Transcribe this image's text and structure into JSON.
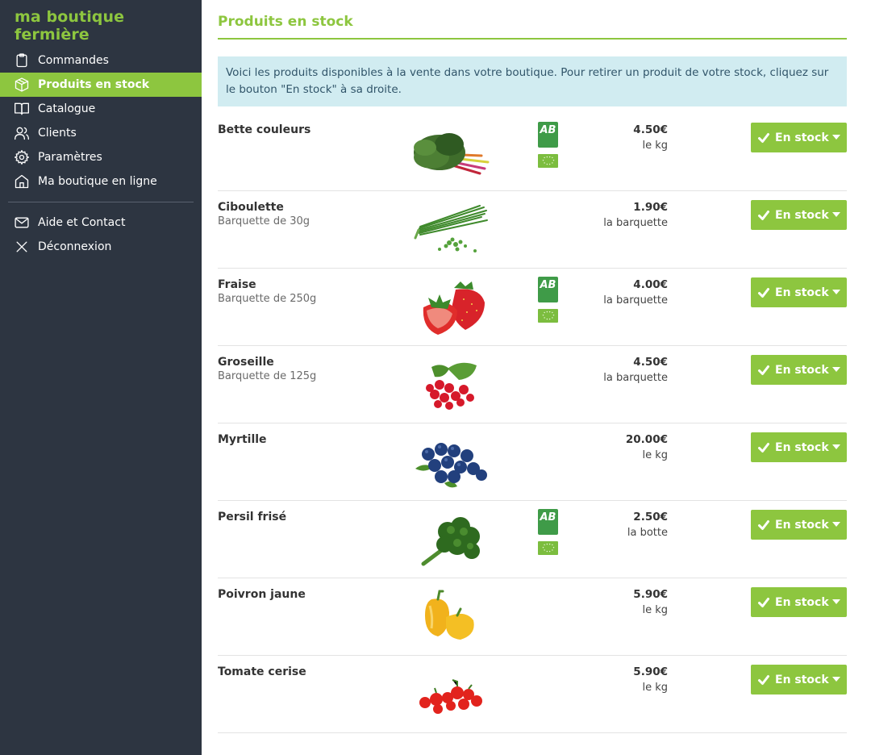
{
  "brand": "ma boutique fermière",
  "sidebar": {
    "items": [
      {
        "label": "Commandes",
        "icon": "clipboard-icon"
      },
      {
        "label": "Produits en stock",
        "icon": "box-icon",
        "active": true
      },
      {
        "label": "Catalogue",
        "icon": "book-icon"
      },
      {
        "label": "Clients",
        "icon": "users-icon"
      },
      {
        "label": "Paramètres",
        "icon": "gear-icon"
      },
      {
        "label": "Ma boutique en ligne",
        "icon": "home-icon"
      }
    ],
    "secondary": [
      {
        "label": "Aide et Contact",
        "icon": "mail-icon"
      },
      {
        "label": "Déconnexion",
        "icon": "close-icon"
      }
    ]
  },
  "main": {
    "title": "Produits en stock",
    "info": "Voici les produits disponibles à la vente dans votre boutique. Pour retirer un produit de votre stock, cliquez sur le bouton \"En stock\" à sa droite."
  },
  "products": [
    {
      "name": "Bette couleurs",
      "sub": "",
      "price": "4.50€",
      "unit": "le kg",
      "bio": true,
      "image": "chard-image"
    },
    {
      "name": "Ciboulette",
      "sub": "Barquette de 30g",
      "price": "1.90€",
      "unit": "la barquette",
      "bio": false,
      "image": "chives-image"
    },
    {
      "name": "Fraise",
      "sub": "Barquette de 250g",
      "price": "4.00€",
      "unit": "la barquette",
      "bio": true,
      "image": "strawberry-image"
    },
    {
      "name": "Groseille",
      "sub": "Barquette de 125g",
      "price": "4.50€",
      "unit": "la barquette",
      "bio": false,
      "image": "redcurrant-image"
    },
    {
      "name": "Myrtille",
      "sub": "",
      "price": "20.00€",
      "unit": "le kg",
      "bio": false,
      "image": "blueberry-image"
    },
    {
      "name": "Persil frisé",
      "sub": "",
      "price": "2.50€",
      "unit": "la botte",
      "bio": true,
      "image": "parsley-image"
    },
    {
      "name": "Poivron jaune",
      "sub": "",
      "price": "5.90€",
      "unit": "le kg",
      "bio": false,
      "image": "yellow-pepper-image"
    },
    {
      "name": "Tomate cerise",
      "sub": "",
      "price": "5.90€",
      "unit": "le kg",
      "bio": false,
      "image": "cherry-tomato-image"
    }
  ],
  "stock_button_label": "En stock",
  "bio_label": "AB",
  "colors": {
    "accent": "#8dc63f",
    "sidebar": "#2d3541",
    "info_bg": "#d1ecf1"
  }
}
